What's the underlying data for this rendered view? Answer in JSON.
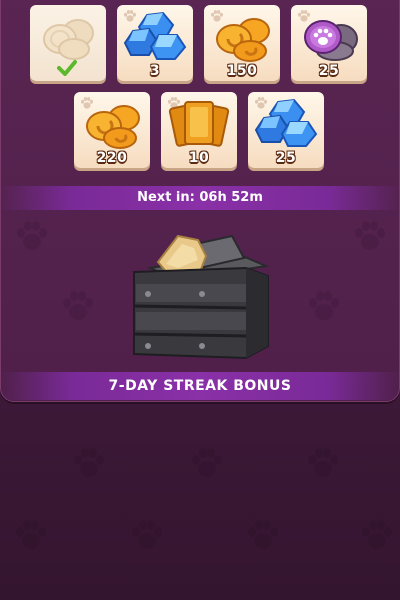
{
  "rewards": [
    {
      "id": "day1",
      "item": "coins",
      "quantity": "",
      "claimed": true,
      "icon": "coins-icon"
    },
    {
      "id": "day2",
      "item": "gems",
      "quantity": "3",
      "claimed": false,
      "icon": "gems-icon"
    },
    {
      "id": "day3",
      "item": "coins",
      "quantity": "150",
      "claimed": false,
      "icon": "coins-icon"
    },
    {
      "id": "day4",
      "item": "paw-tokens",
      "quantity": "25",
      "claimed": false,
      "icon": "paw-token-icon"
    },
    {
      "id": "day5",
      "item": "coins",
      "quantity": "220",
      "claimed": false,
      "icon": "coins-icon"
    },
    {
      "id": "day6",
      "item": "cards",
      "quantity": "10",
      "claimed": false,
      "icon": "cards-icon"
    },
    {
      "id": "day7",
      "item": "gems",
      "quantity": "25",
      "claimed": false,
      "icon": "gems-icon"
    }
  ],
  "timer": {
    "label": "Next in: 06h 52m"
  },
  "streak": {
    "title": "7-DAY STREAK BONUS",
    "icon": "chest-icon"
  },
  "colors": {
    "accent": "#8a30a8",
    "panel": "#5a2553",
    "tile": "#f6dcc0",
    "coin": "#f29a1c",
    "gem": "#3aa0f0"
  }
}
